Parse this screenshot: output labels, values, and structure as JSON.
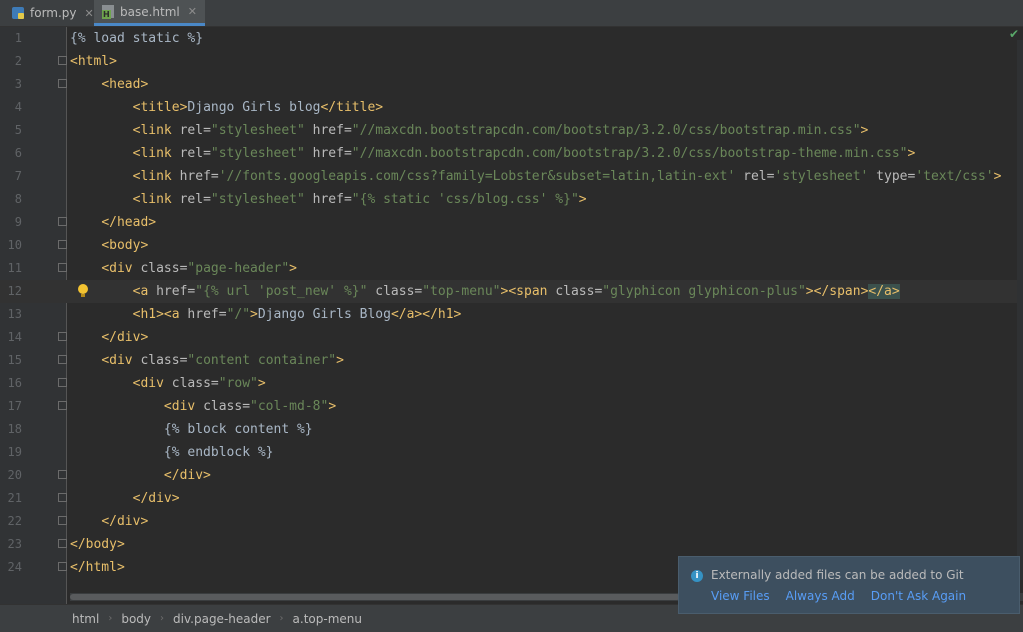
{
  "tabs": [
    {
      "label": "form.py",
      "icon": "python-file-icon",
      "active": false
    },
    {
      "label": "base.html",
      "icon": "html-file-icon",
      "active": true
    }
  ],
  "editor": {
    "current_line": 12,
    "lines": [
      {
        "n": "1",
        "tokens": [
          [
            "dj",
            "{% load static %}"
          ]
        ]
      },
      {
        "n": "2",
        "tokens": [
          [
            "t",
            "<html>"
          ]
        ]
      },
      {
        "n": "3",
        "tokens": [
          [
            "txt",
            "    "
          ],
          [
            "t",
            "<head>"
          ]
        ]
      },
      {
        "n": "4",
        "tokens": [
          [
            "txt",
            "        "
          ],
          [
            "t",
            "<title>"
          ],
          [
            "txt",
            "Django Girls blog"
          ],
          [
            "t",
            "</title>"
          ]
        ]
      },
      {
        "n": "5",
        "tokens": [
          [
            "txt",
            "        "
          ],
          [
            "t",
            "<link "
          ],
          [
            "a",
            "rel="
          ],
          [
            "s",
            "\"stylesheet\""
          ],
          [
            "a",
            " href="
          ],
          [
            "s",
            "\"//maxcdn.bootstrapcdn.com/bootstrap/3.2.0/css/bootstrap.min.css\""
          ],
          [
            "t",
            ">"
          ]
        ]
      },
      {
        "n": "6",
        "tokens": [
          [
            "txt",
            "        "
          ],
          [
            "t",
            "<link "
          ],
          [
            "a",
            "rel="
          ],
          [
            "s",
            "\"stylesheet\""
          ],
          [
            "a",
            " href="
          ],
          [
            "s",
            "\"//maxcdn.bootstrapcdn.com/bootstrap/3.2.0/css/bootstrap-theme.min.css\""
          ],
          [
            "t",
            ">"
          ]
        ]
      },
      {
        "n": "7",
        "tokens": [
          [
            "txt",
            "        "
          ],
          [
            "t",
            "<link "
          ],
          [
            "a",
            "href="
          ],
          [
            "s",
            "'//fonts.googleapis.com/css?family=Lobster&subset=latin,latin-ext'"
          ],
          [
            "a",
            " rel="
          ],
          [
            "s",
            "'stylesheet'"
          ],
          [
            "a",
            " type="
          ],
          [
            "s",
            "'text/css'"
          ],
          [
            "t",
            ">"
          ]
        ]
      },
      {
        "n": "8",
        "tokens": [
          [
            "txt",
            "        "
          ],
          [
            "t",
            "<link "
          ],
          [
            "a",
            "rel="
          ],
          [
            "s",
            "\"stylesheet\""
          ],
          [
            "a",
            " href="
          ],
          [
            "s",
            "\"{% static 'css/blog.css' %}\""
          ],
          [
            "t",
            ">"
          ]
        ]
      },
      {
        "n": "9",
        "tokens": [
          [
            "txt",
            "    "
          ],
          [
            "t",
            "</head>"
          ]
        ]
      },
      {
        "n": "10",
        "tokens": [
          [
            "txt",
            "    "
          ],
          [
            "t",
            "<body>"
          ]
        ]
      },
      {
        "n": "11",
        "tokens": [
          [
            "txt",
            "    "
          ],
          [
            "t",
            "<div "
          ],
          [
            "a",
            "class="
          ],
          [
            "s",
            "\"page-header\""
          ],
          [
            "t",
            ">"
          ]
        ]
      },
      {
        "n": "12",
        "tokens": [
          [
            "txt",
            "        "
          ],
          [
            "t",
            "<a "
          ],
          [
            "a",
            "href="
          ],
          [
            "s",
            "\"{% url 'post_new' %}\""
          ],
          [
            "a",
            " class="
          ],
          [
            "s",
            "\"top-menu\""
          ],
          [
            "t",
            "><span "
          ],
          [
            "a",
            "class="
          ],
          [
            "s",
            "\"glyphicon glyphicon-plus\""
          ],
          [
            "t",
            "></span>"
          ],
          [
            "t",
            "</a>"
          ]
        ]
      },
      {
        "n": "13",
        "tokens": [
          [
            "txt",
            "        "
          ],
          [
            "t",
            "<h1><a "
          ],
          [
            "a",
            "href="
          ],
          [
            "s",
            "\"/\""
          ],
          [
            "t",
            ">"
          ],
          [
            "txt",
            "Django Girls Blog"
          ],
          [
            "t",
            "</a></h1>"
          ]
        ]
      },
      {
        "n": "14",
        "tokens": [
          [
            "txt",
            "    "
          ],
          [
            "t",
            "</div>"
          ]
        ]
      },
      {
        "n": "15",
        "tokens": [
          [
            "txt",
            "    "
          ],
          [
            "t",
            "<div "
          ],
          [
            "a",
            "class="
          ],
          [
            "s",
            "\"content container\""
          ],
          [
            "t",
            ">"
          ]
        ]
      },
      {
        "n": "16",
        "tokens": [
          [
            "txt",
            "        "
          ],
          [
            "t",
            "<div "
          ],
          [
            "a",
            "class="
          ],
          [
            "s",
            "\"row\""
          ],
          [
            "t",
            ">"
          ]
        ]
      },
      {
        "n": "17",
        "tokens": [
          [
            "txt",
            "            "
          ],
          [
            "t",
            "<div "
          ],
          [
            "a",
            "class="
          ],
          [
            "s",
            "\"col-md-8\""
          ],
          [
            "t",
            ">"
          ]
        ]
      },
      {
        "n": "18",
        "tokens": [
          [
            "txt",
            "            "
          ],
          [
            "dj",
            "{% block content %}"
          ]
        ]
      },
      {
        "n": "19",
        "tokens": [
          [
            "txt",
            "            "
          ],
          [
            "dj",
            "{% endblock %}"
          ]
        ]
      },
      {
        "n": "20",
        "tokens": [
          [
            "txt",
            "            "
          ],
          [
            "t",
            "</div>"
          ]
        ]
      },
      {
        "n": "21",
        "tokens": [
          [
            "txt",
            "        "
          ],
          [
            "t",
            "</div>"
          ]
        ]
      },
      {
        "n": "22",
        "tokens": [
          [
            "txt",
            "    "
          ],
          [
            "t",
            "</div>"
          ]
        ]
      },
      {
        "n": "23",
        "tokens": [
          [
            "t",
            "</body>"
          ]
        ]
      },
      {
        "n": "24",
        "tokens": [
          [
            "t",
            "</html>"
          ]
        ]
      }
    ],
    "fold_lines": [
      "2",
      "3",
      "9",
      "10",
      "11",
      "14",
      "15",
      "16",
      "17",
      "20",
      "21",
      "22",
      "23",
      "24"
    ]
  },
  "breadcrumbs": [
    "html",
    "body",
    "div.page-header",
    "a.top-menu"
  ],
  "notification": {
    "message": "Externally added files can be added to Git",
    "actions": [
      "View Files",
      "Always Add",
      "Don't Ask Again"
    ]
  },
  "colors": {
    "tag": "#e8bf6a",
    "attribute": "#bababa",
    "string": "#6a8759",
    "text": "#a9b7c6",
    "background": "#2b2b2b",
    "link": "#589df6"
  }
}
